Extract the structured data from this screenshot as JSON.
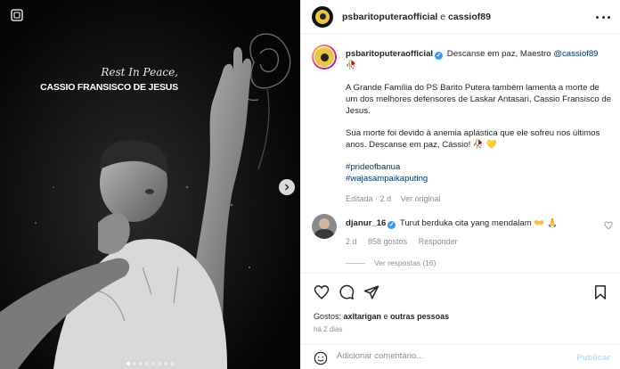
{
  "media": {
    "caption_script": "Rest In Peace,",
    "caption_name": "CASSIO FRANSISCO DE JESUS",
    "slide_count": 8,
    "active_slide": 1,
    "icon_multi": "carousel-icon",
    "icon_next": "chevron-right-icon"
  },
  "header": {
    "users": "psbaritoputeraofficial",
    "joiner": " e ",
    "collab": "cassiof89",
    "icon_more": "more-horizontal-icon"
  },
  "caption": {
    "username": "psbaritoputeraofficial",
    "first_line": "Descanse em paz, Maestro ",
    "mention": "@cassiof89",
    "first_emoji": "🥀",
    "para1": "A Grande Família do PS Barito Putera também lamenta a morte de um dos melhores defensores de Laskar Antasari, Cassio Fransisco de Jesus.",
    "para2": "Sua morte foi devido à anemia aplástica que ele sofreu nos últimos anos. Descanse em paz, Cássio! 🥀 💛",
    "hashtag1": "#prideofbanua",
    "hashtag2": "#wajasampaikaputing",
    "edited": "Editada · 2 d",
    "see_translation": "Ver original"
  },
  "reply": {
    "username": "djanur_16",
    "text": "Turut berduka cita yang mendalam 👐 🙏",
    "time": "2 d",
    "likes": "858 gostos",
    "reply_label": "Responder",
    "view_replies": "Ver respostas (16)"
  },
  "actions": {
    "like_icon": "heart-icon",
    "comment_icon": "comment-icon",
    "share_icon": "share-icon",
    "save_icon": "bookmark-icon"
  },
  "likes": {
    "prefix": "Gostos: ",
    "who": "axltarigan",
    "suffix": " e ",
    "others": "outras pessoas"
  },
  "timestamp": "há 2 dias",
  "add_comment": {
    "placeholder": "Adicionar comentário...",
    "post_label": "Publicar",
    "emoji_icon": "emoji-icon"
  },
  "colors": {
    "link": "#00376b",
    "verified": "#3897f0",
    "muted": "#8e8e8e",
    "post_disabled": "#b2dffc"
  }
}
